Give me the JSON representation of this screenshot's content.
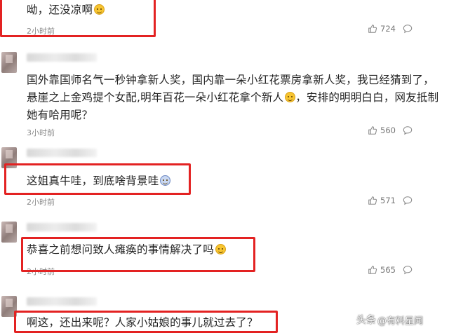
{
  "comments": [
    {
      "text": "呦，还没凉啊",
      "emoji": "smile-emoji",
      "time": "2小时前",
      "likes": "724",
      "highlighted": true
    },
    {
      "text": "国外靠国师名气一秒钟拿新人奖，国内靠一朵小红花票房拿新人奖，我已经猜到了，悬崖之上金鸡提个女配,明年百花一朵小红花拿个新人",
      "text2": "，安排的明明白白，网友抵制她有哈用呢？",
      "emoji": "laugh-emoji",
      "time": "3小时前",
      "likes": "560",
      "highlighted": false
    },
    {
      "text": "这姐真牛哇，到底啥背景哇",
      "emoji": "dizzy-emoji",
      "time": "2小时前",
      "likes": "571",
      "highlighted": true
    },
    {
      "text": "恭喜之前想问致人瘫痪的事情解决了吗",
      "emoji": "sweat-emoji",
      "time": "2小时前",
      "likes": "565",
      "highlighted": true
    },
    {
      "text": "啊这，还出来呢？人家小姑娘的事儿就过去了？",
      "highlighted": true
    }
  ],
  "watermark": {
    "brand": "头条",
    "handle": "@有料星闻"
  },
  "colors": {
    "highlight": "#e32222",
    "meta": "#8a8a8a",
    "text": "#222222"
  }
}
